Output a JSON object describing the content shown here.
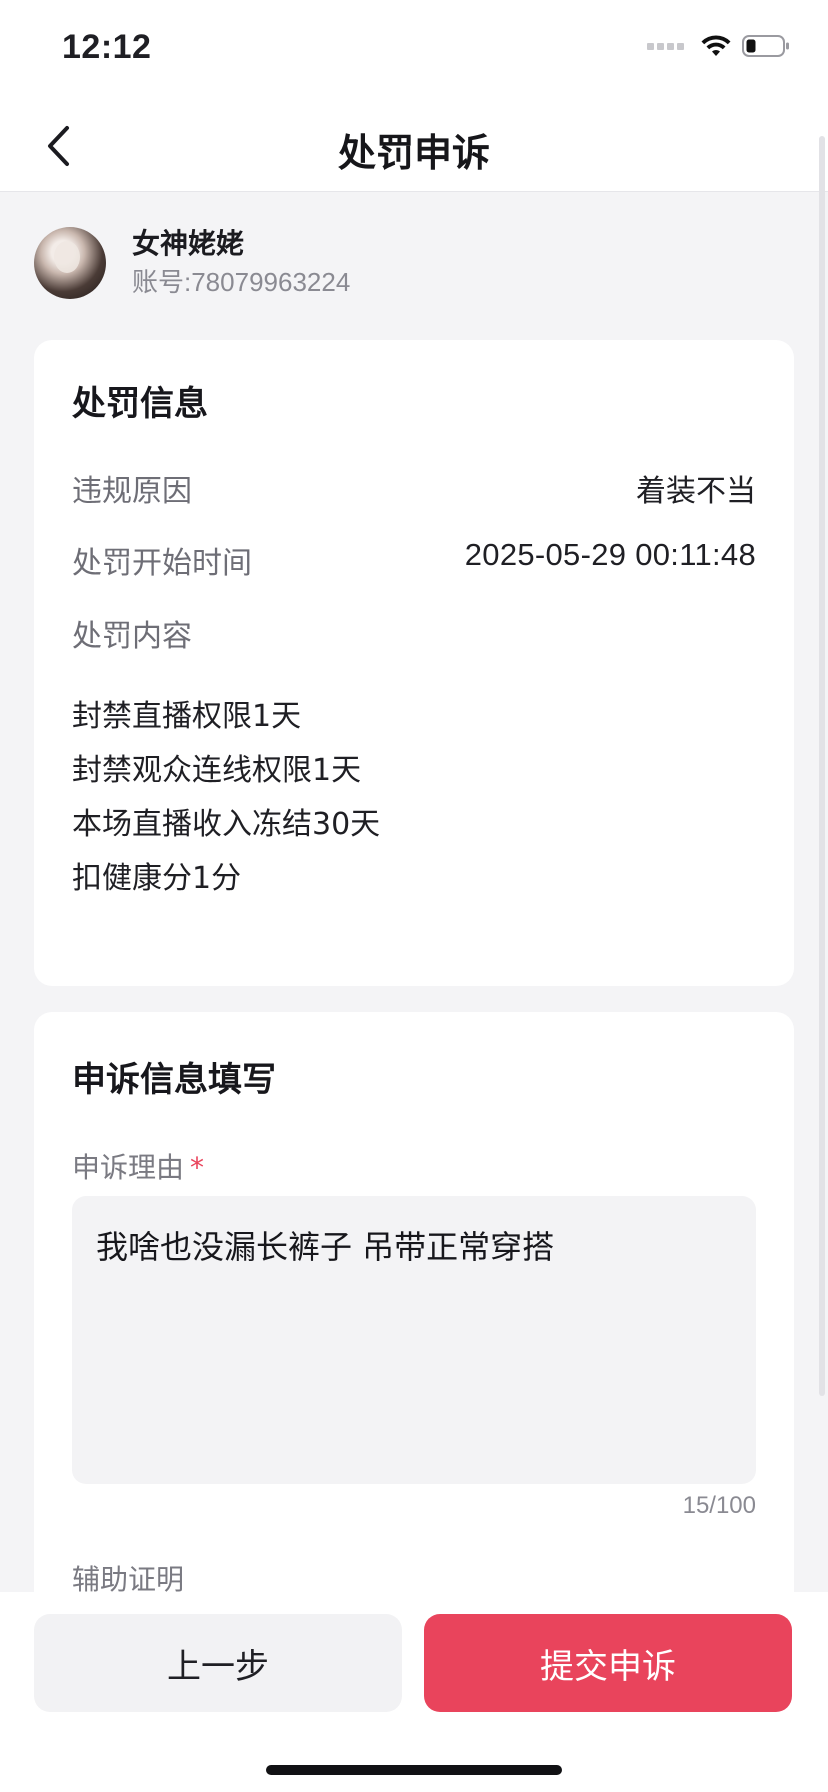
{
  "status_bar": {
    "time": "12:12",
    "icons": [
      "signal-dots-icon",
      "wifi-icon",
      "battery-icon"
    ]
  },
  "nav": {
    "title": "处罚申诉",
    "back_icon": "chevron-left-icon"
  },
  "user": {
    "name": "女神姥姥",
    "account": "账号:78079963224"
  },
  "penalty_info": {
    "title": "处罚信息",
    "reason_label": "违规原因",
    "reason_value": "着装不当",
    "start_time_label": "处罚开始时间",
    "start_time_value": "2025-05-29 00:11:48",
    "content_label": "处罚内容",
    "items": [
      "封禁直播权限1天",
      "封禁观众连线权限1天",
      "本场直播收入冻结30天",
      "扣健康分1分"
    ]
  },
  "appeal_form": {
    "title": "申诉信息填写",
    "reason_label": "申诉理由",
    "required_mark": "*",
    "reason_text": "我啥也没漏长裤子 吊带正常穿搭",
    "counter": "15/100",
    "evidence_label": "辅助证明"
  },
  "actions": {
    "prev_label": "上一步",
    "submit_label": "提交申诉"
  },
  "colors": {
    "accent": "#e9445c",
    "background": "#f4f4f6",
    "card": "#ffffff"
  }
}
